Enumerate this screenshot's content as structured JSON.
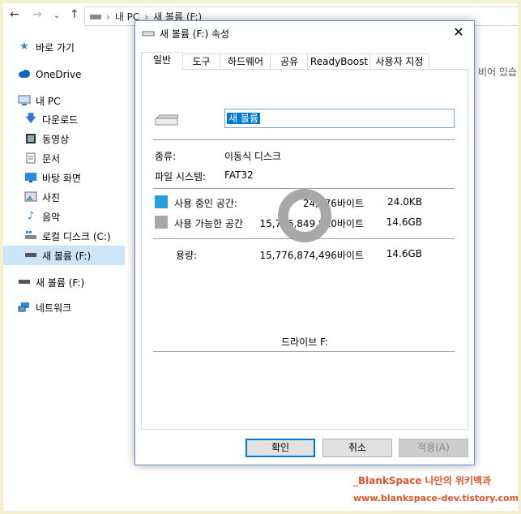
{
  "explorer": {
    "breadcrumb": [
      "내 PC",
      "새 볼륨 (F:)"
    ],
    "right_text": "비어 있습",
    "sidebar": [
      {
        "label": "바로 가기",
        "icon": "star-icon"
      },
      {
        "label": "OneDrive",
        "icon": "cloud-icon"
      },
      {
        "label": "내 PC",
        "icon": "computer-icon"
      },
      {
        "label": "다운로드",
        "icon": "download-arrow-icon"
      },
      {
        "label": "동영상",
        "icon": "video-icon"
      },
      {
        "label": "문서",
        "icon": "document-icon"
      },
      {
        "label": "바탕 화면",
        "icon": "desktop-icon"
      },
      {
        "label": "사진",
        "icon": "picture-icon"
      },
      {
        "label": "음악",
        "icon": "music-icon"
      },
      {
        "label": "로컬 디스크 (C:)",
        "icon": "local-disk-icon"
      },
      {
        "label": "새 볼륨 (F:)",
        "icon": "removable-drive-icon",
        "selected": true
      },
      {
        "label": "새 볼륨 (F:)",
        "icon": "removable-drive-icon"
      },
      {
        "label": "네트워크",
        "icon": "network-icon"
      }
    ]
  },
  "dialog": {
    "title": "새 볼륨 (F:) 속성",
    "close_glyph": "✕",
    "tabs": [
      "일반",
      "도구",
      "하드웨어",
      "공유",
      "ReadyBoost",
      "사용자 지정"
    ],
    "volume_name": "새 볼륨",
    "type_label": "종류:",
    "type_value": "이동식 디스크",
    "fs_label": "파일 시스템:",
    "fs_value": "FAT32",
    "used_label": "사용 중인 공간:",
    "used_bytes": "24,576바이트",
    "used_size": "24.0KB",
    "free_label": "사용 가능한 공간",
    "free_bytes": "15,776,849,920바이트",
    "free_size": "14.6GB",
    "capacity_label": "용량:",
    "capacity_bytes": "15,776,874,496바이트",
    "capacity_size": "14.6GB",
    "drive_caption": "드라이브 F:",
    "used_fraction": 1.6e-06,
    "used_color": "#26a0da",
    "free_color": "#a8a8a8",
    "buttons": {
      "ok": "확인",
      "cancel": "취소",
      "apply": "적용(A)"
    }
  },
  "watermark": {
    "line1": "_BlankSpace 나만의 위키백과",
    "line2": "www.blankspace-dev.tistory.com"
  }
}
